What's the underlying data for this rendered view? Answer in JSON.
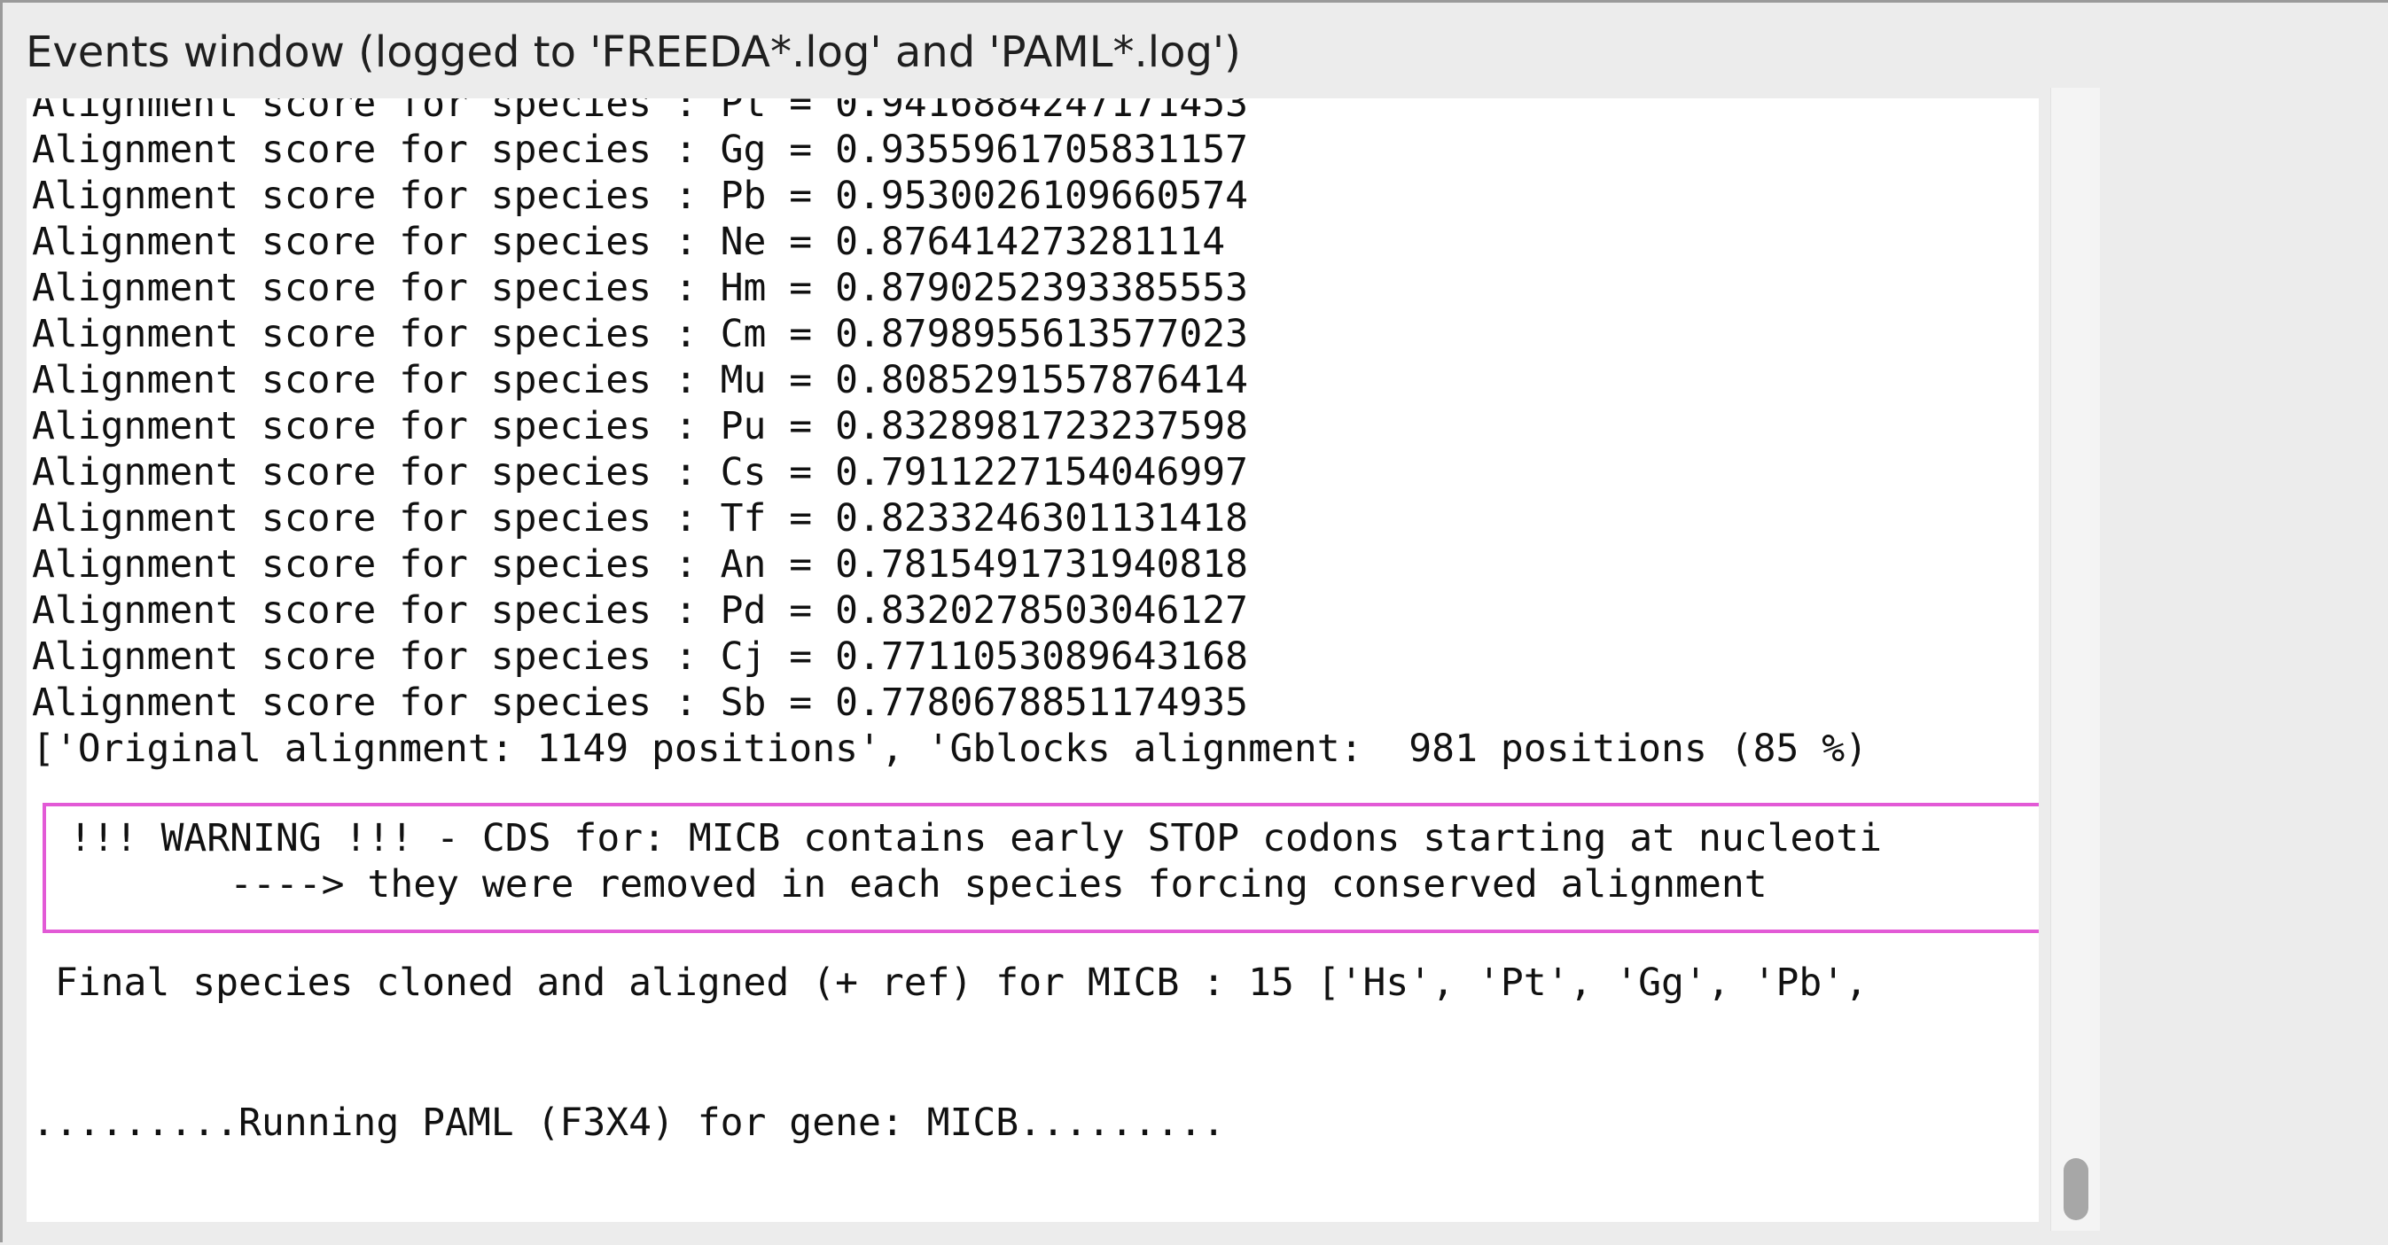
{
  "window": {
    "title": "Events window (logged to 'FREEDA*.log' and 'PAML*.log')"
  },
  "log": {
    "lines": [
      "Alignment score for species : Pt = 0.9416884247171453",
      "Alignment score for species : Gg = 0.9355961705831157",
      "Alignment score for species : Pb = 0.9530026109660574",
      "Alignment score for species : Ne = 0.876414273281114",
      "Alignment score for species : Hm = 0.8790252393385553",
      "Alignment score for species : Cm = 0.8798955613577023",
      "Alignment score for species : Mu = 0.8085291557876414",
      "Alignment score for species : Pu = 0.8328981723237598",
      "Alignment score for species : Cs = 0.7911227154046997",
      "Alignment score for species : Tf = 0.8233246301131418",
      "Alignment score for species : An = 0.7815491731940818",
      "Alignment score for species : Pd = 0.8320278503046127",
      "Alignment score for species : Cj = 0.7711053089643168",
      "Alignment score for species : Sb = 0.7780678851174935",
      "['Original alignment: 1149 positions', 'Gblocks alignment:  981 positions (85 %)"
    ],
    "warning": {
      "line1": " !!! WARNING !!! - CDS for: MICB contains early STOP codons starting at nucleoti",
      "line2": "        ----> they were removed in each species forcing conserved alignment"
    },
    "final_species": " Final species cloned and aligned (+ ref) for MICB : 15 ['Hs', 'Pt', 'Gg', 'Pb',",
    "running": ".........Running PAML (F3X4) for gene: MICB........."
  },
  "colors": {
    "warning_border": "#e25ad6",
    "background": "#ececec",
    "pane": "#ffffff"
  }
}
